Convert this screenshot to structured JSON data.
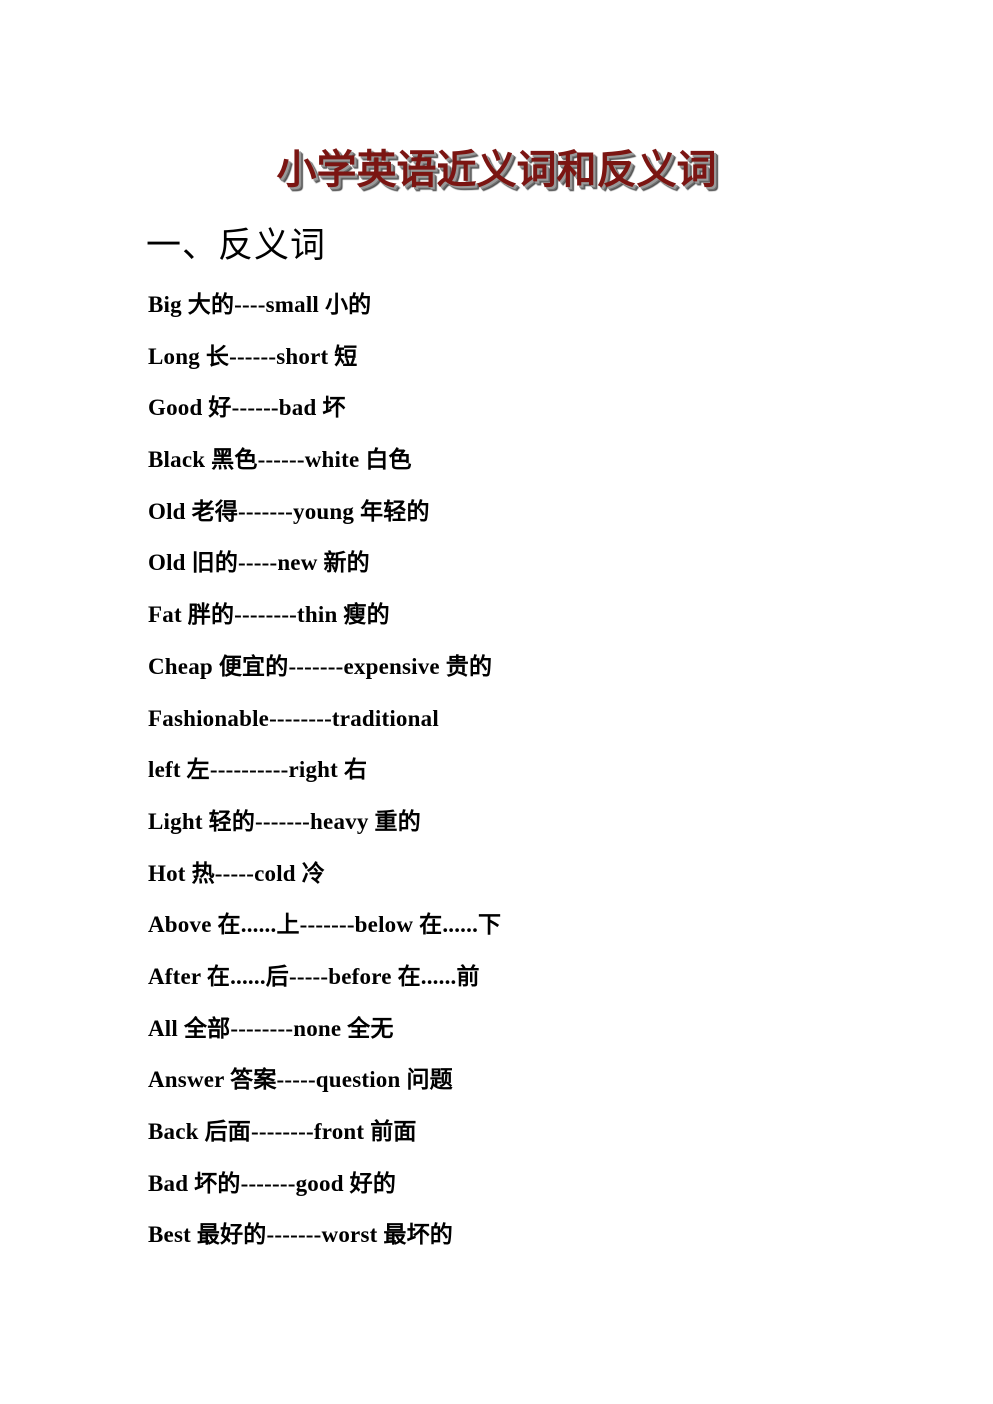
{
  "document": {
    "title": "小学英语近义词和反义词",
    "title_color": "#7B1512",
    "shadow_color": "#6f6f6f",
    "background_color": "#ffffff",
    "text_color": "#000000"
  },
  "section": {
    "heading": "一、反义词"
  },
  "pairs": [
    {
      "text": "Big 大的----small 小的"
    },
    {
      "text": "Long 长------short 短"
    },
    {
      "text": "Good 好------bad 坏"
    },
    {
      "text": "Black 黑色------white 白色"
    },
    {
      "text": "Old 老得-------young 年轻的"
    },
    {
      "text": "Old 旧的-----new 新的"
    },
    {
      "text": "Fat 胖的--------thin 瘦的"
    },
    {
      "text": "Cheap 便宜的-------expensive 贵的"
    },
    {
      "text": "Fashionable--------traditional"
    },
    {
      "text": "left 左----------right 右"
    },
    {
      "text": "Light 轻的-------heavy 重的"
    },
    {
      "text": "Hot 热-----cold 冷"
    },
    {
      "text": "Above 在......上-------below 在......下"
    },
    {
      "text": "After 在......后-----before 在......前"
    },
    {
      "text": "All 全部--------none 全无"
    },
    {
      "text": "Answer 答案-----question 问题"
    },
    {
      "text": "Back 后面--------front 前面"
    },
    {
      "text": "Bad 坏的-------good 好的"
    },
    {
      "text": "Best 最好的-------worst 最坏的"
    }
  ]
}
